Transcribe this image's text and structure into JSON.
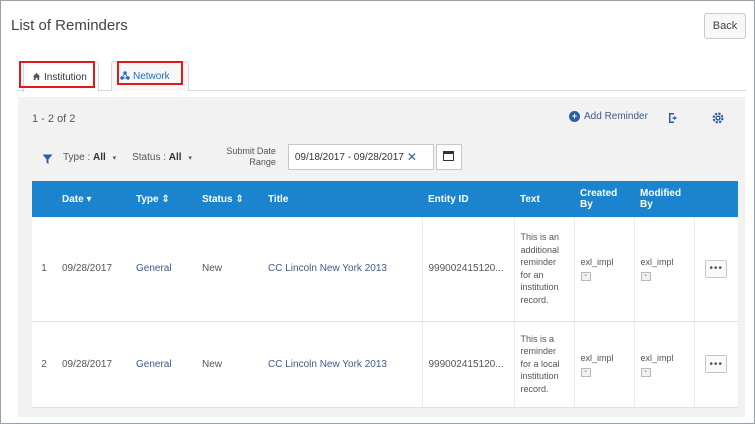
{
  "page": {
    "title": "List of Reminders",
    "back_label": "Back"
  },
  "tabs": [
    {
      "label": "Institution",
      "icon": "home-icon"
    },
    {
      "label": "Network",
      "icon": "network-icon"
    }
  ],
  "toolbar": {
    "count": "1 - 2 of 2",
    "add_reminder": "Add Reminder"
  },
  "filters": {
    "type_label": "Type :",
    "type_value": "All",
    "status_label": "Status :",
    "status_value": "All",
    "date_label_line1": "Submit Date",
    "date_label_line2": "Range",
    "date_value": "09/18/2017 - 09/28/2017"
  },
  "table": {
    "headers": {
      "date": "Date ▾",
      "type": "Type ⇕",
      "status": "Status ⇕",
      "title": "Title",
      "entity": "Entity ID",
      "text": "Text",
      "created": "Created By",
      "modified": "Modified By"
    },
    "rows": [
      {
        "index": "1",
        "date": "09/28/2017",
        "type": "General",
        "status": "New",
        "title": "CC Lincoln New York 2013",
        "entity": "999002415120...",
        "text": "This is an additional reminder for an institution record.",
        "created": "exl_impl",
        "modified": "exl_impl"
      },
      {
        "index": "2",
        "date": "09/28/2017",
        "type": "General",
        "status": "New",
        "title": "CC Lincoln New York 2013",
        "entity": "999002415120...",
        "text": "This is a reminder for a local institution record.",
        "created": "exl_impl",
        "modified": "exl_impl"
      }
    ]
  },
  "colors": {
    "header_blue": "#1a84ce",
    "link_blue": "#3d5c88",
    "highlight_red": "#e0191d",
    "panel_gray": "#f2f2f2"
  }
}
